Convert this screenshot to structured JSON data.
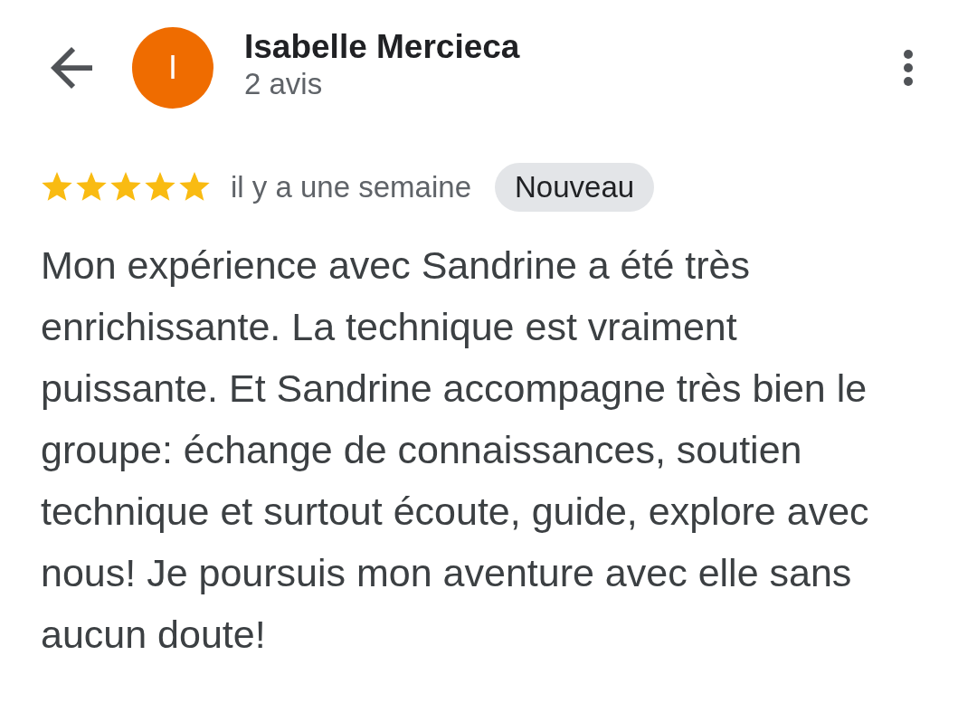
{
  "reviewer": {
    "initial": "I",
    "name": "Isabelle Mercieca",
    "review_count": "2 avis"
  },
  "review": {
    "stars": 5,
    "time": "il y a une semaine",
    "badge": "Nouveau",
    "text": "Mon expérience avec Sandrine a été très enrichissante. La technique est vraiment puissante. Et Sandrine accompagne très bien le groupe: échange de connaissances, soutien technique et surtout écoute, guide, explore avec nous! Je poursuis mon aventure avec elle sans aucun doute!"
  }
}
